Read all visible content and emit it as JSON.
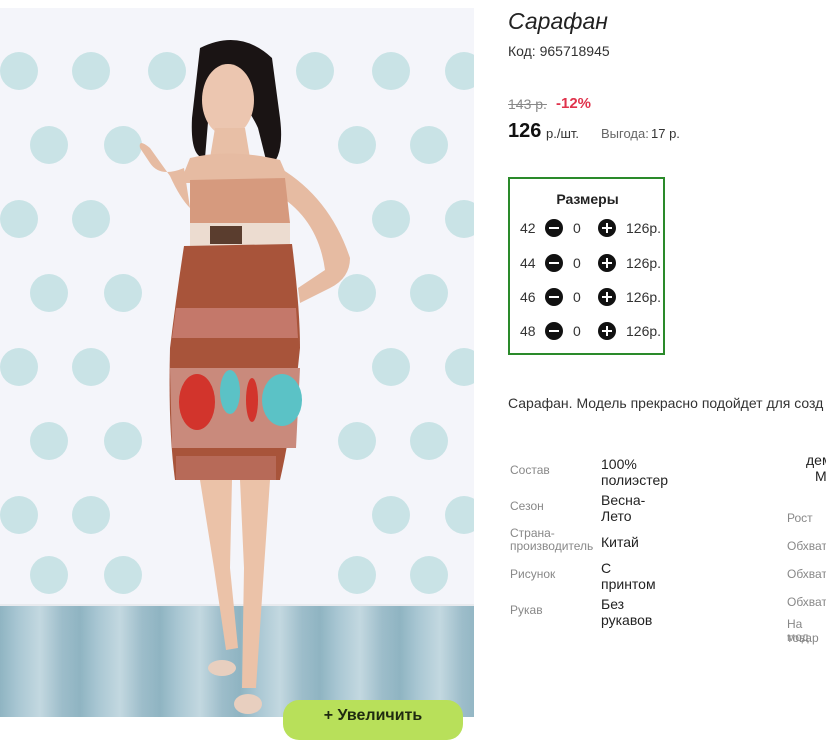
{
  "product": {
    "title": "Сарафан",
    "code": "Код: 965718945",
    "old_price": "143 р.",
    "discount": "-12%",
    "price": "126",
    "unit": "р./шт.",
    "benefit_label": "Выгода:",
    "benefit_value": "17 р."
  },
  "sizes": {
    "title": "Размеры",
    "rows": [
      {
        "size": "42",
        "qty": "0",
        "price": "126р."
      },
      {
        "size": "44",
        "qty": "0",
        "price": "126р."
      },
      {
        "size": "46",
        "qty": "0",
        "price": "126р."
      },
      {
        "size": "48",
        "qty": "0",
        "price": "126р."
      }
    ]
  },
  "description": "Сарафан. Модель прекрасно подойдет для созд",
  "specs": [
    {
      "label": "Состав",
      "value": "100% полиэстер"
    },
    {
      "label": "Сезон",
      "value": "Весна-Лето"
    },
    {
      "label": "Страна-производитель",
      "value": "Китай"
    },
    {
      "label": "Рисунок",
      "value": "С принтом"
    },
    {
      "label": "Рукав",
      "value": "Без рукавов"
    }
  ],
  "right_specs": {
    "top_line1": "дем",
    "top_line2": "М",
    "labels": [
      "Рост",
      "Обхват",
      "Обхват",
      "Обхват",
      "На мод",
      "товар"
    ]
  },
  "zoom_button": "+ Увеличить",
  "colors": {
    "accent_green": "#2a8a2a",
    "discount_red": "#e0334c",
    "button_green": "#b8e05a"
  }
}
